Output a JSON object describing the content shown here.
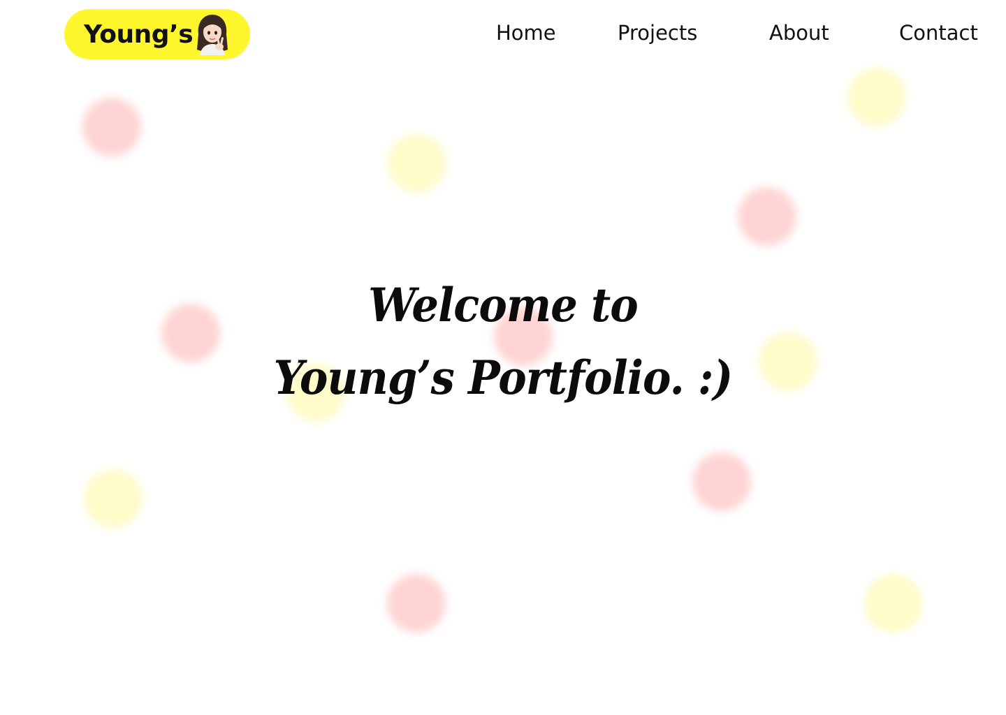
{
  "header": {
    "logo_text": "Young’s",
    "nav": {
      "home": "Home",
      "projects": "Projects",
      "about": "About",
      "contact": "Contact"
    }
  },
  "hero": {
    "line1": "Welcome to",
    "line2": "Young’s Portfolio. :)"
  },
  "colors": {
    "accent": "#fff62e",
    "dot_pink": "#ffd4d4",
    "dot_yellow": "#fffbc9",
    "text": "#111111",
    "background": "#ffffff"
  },
  "icons": {
    "avatar": "girl-memoji-peace-sign-icon"
  }
}
